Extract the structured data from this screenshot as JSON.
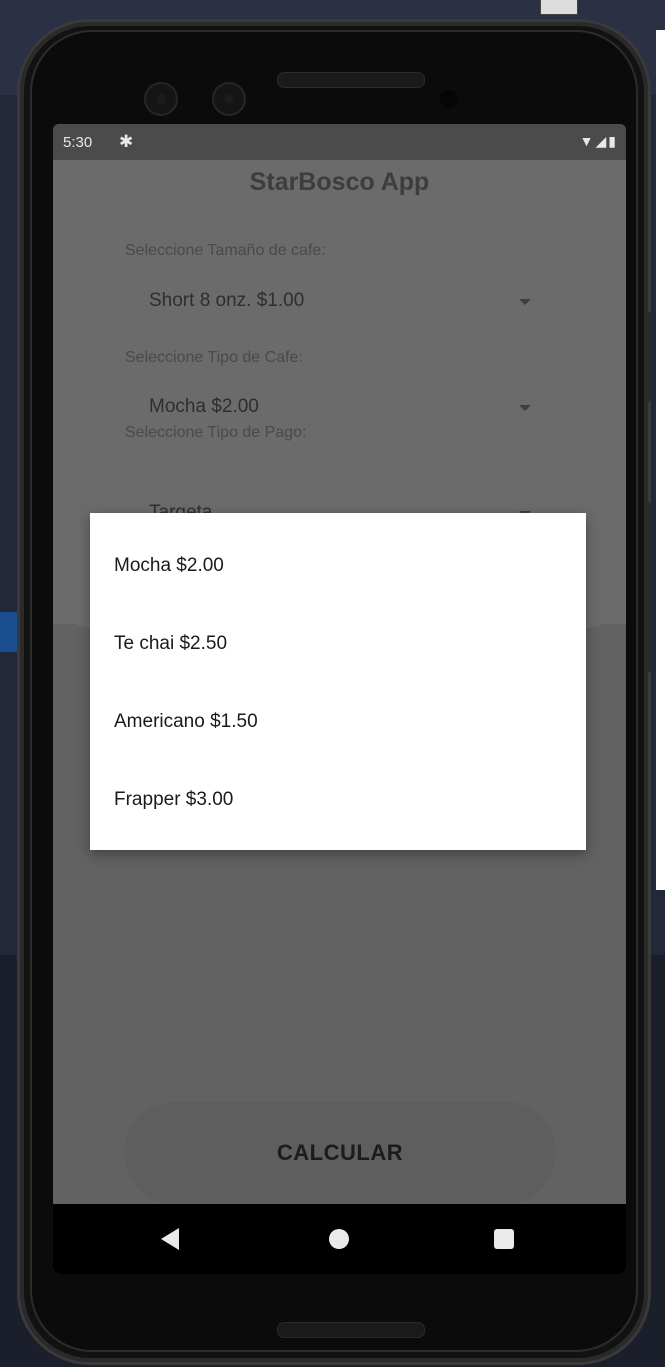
{
  "status": {
    "time": "5:30"
  },
  "app": {
    "title": "StarBosco App"
  },
  "form": {
    "size_label": "Seleccione Tamaño de cafe:",
    "size_value": "Short 8 onz. $1.00",
    "type_label": "Seleccione Tipo de Cafe:",
    "type_value": "Mocha $2.00",
    "payment_label": "Seleccione Tipo de Pago:",
    "payment_value": "Targeta"
  },
  "dropdown": {
    "options": [
      "Mocha $2.00",
      "Te chai $2.50",
      "Americano $1.50",
      "Frapper $3.00"
    ]
  },
  "actions": {
    "calculate_label": "CALCULAR"
  },
  "icons": {
    "gear": "gear-icon",
    "wifi": "wifi-icon",
    "signal": "signal-icon",
    "battery": "battery-icon",
    "back": "back-icon",
    "home": "home-icon",
    "recents": "recents-icon"
  }
}
